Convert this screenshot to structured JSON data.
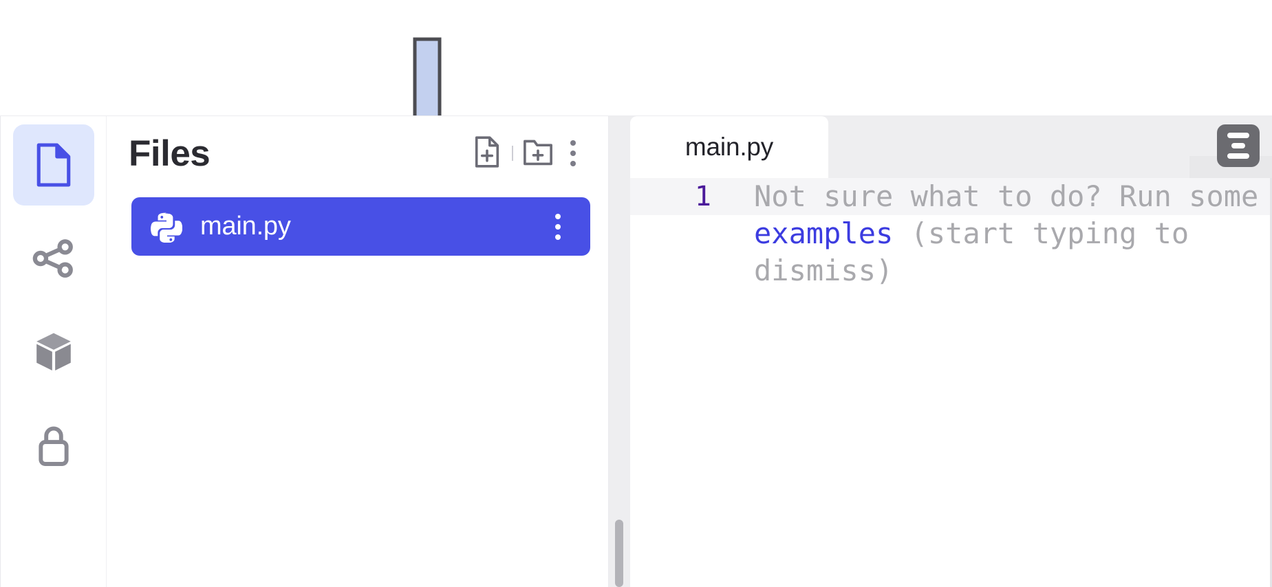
{
  "colors": {
    "accent": "#4850e6",
    "accent_soft": "#dfe7fd",
    "icon_gray": "#8a8a93",
    "tab_bar": "#eeeef0",
    "annotation_fill": "#c3d0ef",
    "annotation_stroke": "#4c4c52",
    "line_number": "#4b1a9a",
    "link_blue": "#3c3ce0"
  },
  "sidebar_rail": {
    "items": [
      {
        "icon": "file-icon",
        "label": "Files",
        "active": true
      },
      {
        "icon": "share-icon",
        "label": "Version control",
        "active": false
      },
      {
        "icon": "package-icon",
        "label": "Packages",
        "active": false
      },
      {
        "icon": "lock-icon",
        "label": "Secrets",
        "active": false
      }
    ]
  },
  "files_panel": {
    "title": "Files",
    "actions": [
      {
        "name": "new-file-button",
        "icon": "new-file-icon"
      },
      {
        "name": "new-folder-button",
        "icon": "new-folder-icon"
      },
      {
        "name": "files-more-button",
        "icon": "kebab-menu-icon"
      }
    ],
    "files": [
      {
        "name": "main.py",
        "icon": "python-icon",
        "selected": true
      }
    ]
  },
  "editor": {
    "tabs": [
      {
        "label": "main.py",
        "active": true
      }
    ],
    "tool_button": {
      "name": "editor-format-button",
      "icon": "format-lines-icon"
    },
    "line_numbers": [
      "1"
    ],
    "placeholder": {
      "prefix": "Not sure what to do? Run some ",
      "link": "examples",
      "suffix": " (start typing to dismiss)"
    }
  },
  "annotation": {
    "type": "down-arrow",
    "points_to": "new-file-button"
  }
}
